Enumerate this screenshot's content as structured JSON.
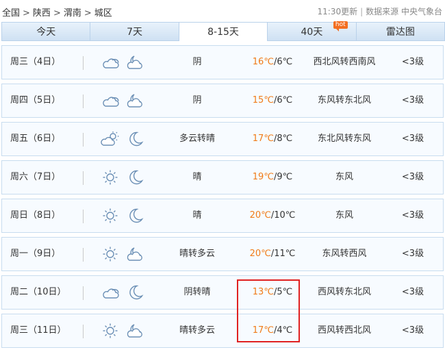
{
  "breadcrumb": [
    "全国",
    "陕西",
    "渭南",
    "城区"
  ],
  "breadcrumb_sep": ">",
  "meta": {
    "updated": "11:30更新",
    "source": "数据来源 中央气象台"
  },
  "tabs": [
    {
      "label": "今天"
    },
    {
      "label": "7天"
    },
    {
      "label": "8-15天",
      "active": true
    },
    {
      "label": "40天",
      "badge": "hot"
    },
    {
      "label": "雷达图"
    }
  ],
  "colors": {
    "high_temp": "#f07b17",
    "highlight_box": "#e02020",
    "tab_bg": "#d6e7f7",
    "row_border": "#c7dcef"
  },
  "rows": [
    {
      "day": "周三（4日）",
      "icon_day": "cloudy-icon",
      "icon_night": "cloudy-moon-icon",
      "condition": "阴",
      "high": "16℃",
      "low": "/6℃",
      "wind": "西北风转西南风",
      "level": "<3级"
    },
    {
      "day": "周四（5日）",
      "icon_day": "cloudy-icon",
      "icon_night": "cloudy-moon-icon",
      "condition": "阴",
      "high": "15℃",
      "low": "/6℃",
      "wind": "东风转东北风",
      "level": "<3级"
    },
    {
      "day": "周五（6日）",
      "icon_day": "partly-cloudy-icon",
      "icon_night": "moon-icon",
      "condition": "多云转晴",
      "high": "17℃",
      "low": "/8℃",
      "wind": "东北风转东风",
      "level": "<3级"
    },
    {
      "day": "周六（7日）",
      "icon_day": "sun-icon",
      "icon_night": "moon-icon",
      "condition": "晴",
      "high": "19℃",
      "low": "/9℃",
      "wind": "东风",
      "level": "<3级"
    },
    {
      "day": "周日（8日）",
      "icon_day": "sun-icon",
      "icon_night": "moon-icon",
      "condition": "晴",
      "high": "20℃",
      "low": "/10℃",
      "wind": "东风",
      "level": "<3级"
    },
    {
      "day": "周一（9日）",
      "icon_day": "sun-icon",
      "icon_night": "cloudy-moon-icon",
      "condition": "晴转多云",
      "high": "20℃",
      "low": "/11℃",
      "wind": "东风转西风",
      "level": "<3级"
    },
    {
      "day": "周二（10日）",
      "icon_day": "cloudy-icon",
      "icon_night": "moon-icon",
      "condition": "阴转晴",
      "high": "13℃",
      "low": "/5℃",
      "wind": "西风转东北风",
      "level": "<3级"
    },
    {
      "day": "周三（11日）",
      "icon_day": "sun-icon",
      "icon_night": "cloudy-moon-icon",
      "condition": "晴转多云",
      "high": "17℃",
      "low": "/4℃",
      "wind": "西风转西北风",
      "level": "<3级"
    }
  ]
}
